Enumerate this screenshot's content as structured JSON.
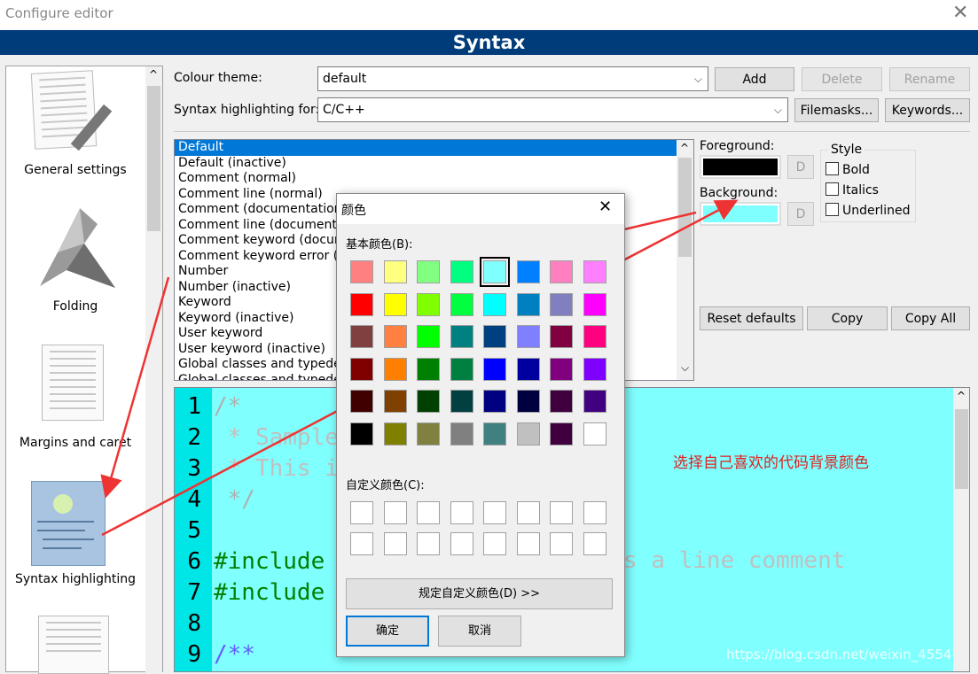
{
  "window": {
    "title": "Configure editor",
    "header": "Syntax"
  },
  "sidebar": {
    "items": [
      {
        "label": "General settings"
      },
      {
        "label": "Folding"
      },
      {
        "label": "Margins and caret"
      },
      {
        "label": "Syntax highlighting"
      },
      {
        "label": ""
      }
    ]
  },
  "theme": {
    "label": "Colour theme:",
    "value": "default",
    "add": "Add",
    "delete": "Delete",
    "rename": "Rename"
  },
  "lang": {
    "label": "Syntax highlighting for:",
    "value": "C/C++",
    "filemasks": "Filemasks...",
    "keywords": "Keywords..."
  },
  "styles": [
    "Default",
    "Default (inactive)",
    "Comment (normal)",
    "Comment line (normal)",
    "Comment (documentation)",
    "Comment line (documentation)",
    "Comment keyword (documentation)",
    "Comment keyword error (documentation)",
    "Number",
    "Number (inactive)",
    "Keyword",
    "Keyword (inactive)",
    "User keyword",
    "User keyword (inactive)",
    "Global classes and typedefs",
    "Global classes and typedefs (inactive)"
  ],
  "props": {
    "foreground": "Foreground:",
    "background": "Background:",
    "d": "D",
    "style": "Style",
    "bold": "Bold",
    "italics": "Italics",
    "underlined": "Underlined",
    "fg_color": "#000000",
    "bg_color": "#80ffff"
  },
  "actions": {
    "reset": "Reset defaults",
    "copy": "Copy",
    "copy_all": "Copy All"
  },
  "preview": {
    "bg": "#80ffff",
    "lines": [
      {
        "num": "1",
        "text": "/*"
      },
      {
        "num": "2",
        "text": " * Sample"
      },
      {
        "num": "3",
        "text": " * This i"
      },
      {
        "num": "4",
        "text": " */"
      },
      {
        "num": "5",
        "text": ""
      },
      {
        "num": "6",
        "text": "#include"
      },
      {
        "num": "7",
        "text": "#include"
      },
      {
        "num": "8",
        "text": ""
      },
      {
        "num": "9",
        "text": "/**"
      }
    ],
    "right_text": "s a line comment"
  },
  "annotation": "选择自己喜欢的代码背景颜色",
  "watermark": "https://blog.csdn.net/weixin_45541762",
  "dialog": {
    "title": "颜色",
    "basic_label": "基本颜色(B):",
    "custom_label": "自定义颜色(C):",
    "define": "规定自定义颜色(D) >>",
    "ok": "确定",
    "cancel": "取消",
    "selected_index": 4,
    "basic_colors": [
      "#ff8080",
      "#ffff80",
      "#80ff80",
      "#00ff80",
      "#80ffff",
      "#0080ff",
      "#ff80c0",
      "#ff80ff",
      "#ff0000",
      "#ffff00",
      "#80ff00",
      "#00ff40",
      "#00ffff",
      "#0080c0",
      "#8080c0",
      "#ff00ff",
      "#804040",
      "#ff8040",
      "#00ff00",
      "#008080",
      "#004080",
      "#8080ff",
      "#800040",
      "#ff0080",
      "#800000",
      "#ff8000",
      "#008000",
      "#008040",
      "#0000ff",
      "#0000a0",
      "#800080",
      "#8000ff",
      "#400000",
      "#804000",
      "#004000",
      "#004040",
      "#000080",
      "#000040",
      "#400040",
      "#400080",
      "#000000",
      "#808000",
      "#808040",
      "#808080",
      "#408080",
      "#c0c0c0",
      "#400040",
      "#ffffff"
    ]
  }
}
